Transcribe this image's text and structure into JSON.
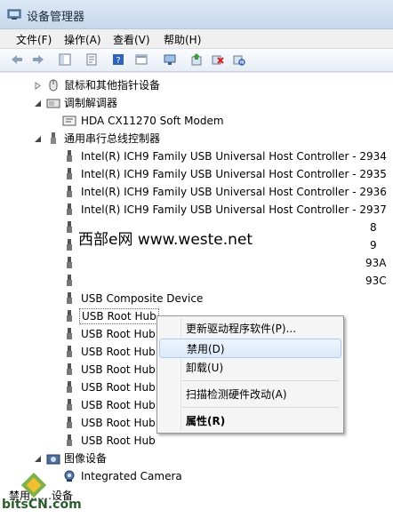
{
  "window": {
    "title": "设备管理器"
  },
  "menu": [
    "文件(F)",
    "操作(A)",
    "查看(V)",
    "帮助(H)"
  ],
  "tree": {
    "top_items": [
      {
        "label": "鼠标和其他指针设备"
      },
      {
        "label": "调制解调器"
      },
      {
        "label": "HDA CX11270 Soft Modem"
      },
      {
        "label": "通用串行总线控制器"
      }
    ],
    "usb_children": [
      "Intel(R) ICH9 Family USB Universal Host Controller - 2934",
      "Intel(R) ICH9 Family USB Universal Host Controller - 2935",
      "Intel(R) ICH9 Family USB Universal Host Controller - 2936",
      "Intel(R) ICH9 Family USB Universal Host Controller - 2937",
      "8",
      "9",
      "93A",
      "93C",
      "USB Composite Device",
      "USB Root Hub",
      "USB Root Hub",
      "USB Root Hub",
      "USB Root Hub",
      "USB Root Hub",
      "USB Root Hub",
      "USB Root Hub",
      "USB Root Hub"
    ],
    "imaging": {
      "label": "图像设备"
    },
    "camera": {
      "label": "Integrated Camera"
    },
    "partial_bottom": "禁用……设备"
  },
  "watermark": "西部e网 www.weste.net",
  "context_menu": {
    "items": [
      "更新驱动程序软件(P)...",
      "禁用(D)",
      "卸载(U)",
      "扫描检测硬件改动(A)",
      "属性(R)"
    ]
  },
  "logo_text": "bitsCN.com"
}
